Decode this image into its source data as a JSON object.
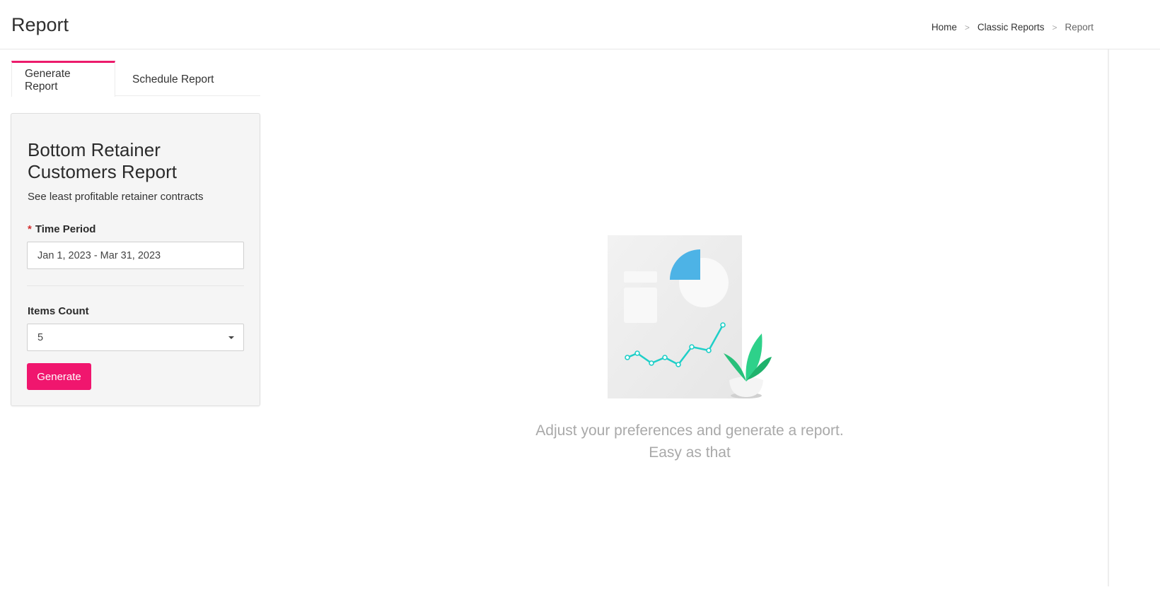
{
  "header": {
    "title": "Report",
    "breadcrumb": [
      "Home",
      "Classic Reports",
      "Report"
    ],
    "separator": ">"
  },
  "tabs": [
    {
      "label": "Generate Report",
      "active": true
    },
    {
      "label": "Schedule Report",
      "active": false
    }
  ],
  "form": {
    "title": "Bottom Retainer Customers Report",
    "description": "See least profitable retainer contracts",
    "time_period": {
      "label": "Time Period",
      "required_mark": "*",
      "value": "Jan 1, 2023 - Mar 31, 2023"
    },
    "items_count": {
      "label": "Items Count",
      "value": "5"
    },
    "generate_label": "Generate"
  },
  "empty_state": {
    "line1": "Adjust your preferences and generate a report.",
    "line2": "Easy as that",
    "illustration_icon": "report-chart-plant-illustration"
  },
  "colors": {
    "accent": "#f0166e",
    "tab_indicator": "#ec1b6b",
    "required": "#d32f2f",
    "chart_line": "#1ecfc8",
    "pie": "#4db3e6",
    "plant": "#2ecc71"
  }
}
